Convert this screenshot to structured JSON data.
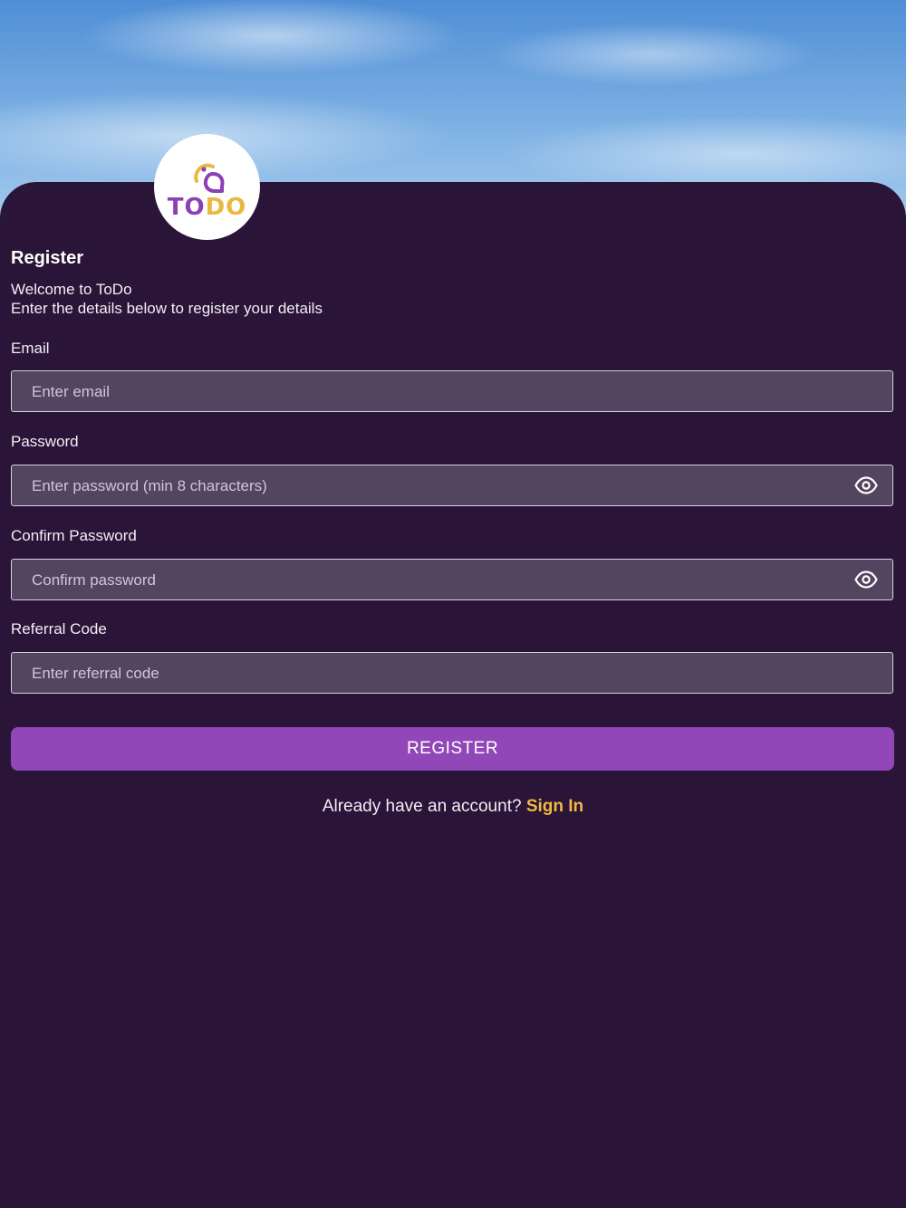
{
  "brand": {
    "logo_word_part1": "TO",
    "logo_word_part2": "DO",
    "logo_icon": "todo-location-pin-icon",
    "accent_purple": "#8d3fb5",
    "accent_gold": "#e9b93f"
  },
  "header": {
    "title": "Register",
    "welcome": "Welcome to ToDo",
    "instructions": "Enter the details below to register your details"
  },
  "form": {
    "email": {
      "label": "Email",
      "placeholder": "Enter email",
      "value": ""
    },
    "password": {
      "label": "Password",
      "placeholder": "Enter password (min 8 characters)",
      "value": "",
      "toggle_icon": "eye-icon"
    },
    "confirm_password": {
      "label": "Confirm Password",
      "placeholder": "Confirm password",
      "value": "",
      "toggle_icon": "eye-icon"
    },
    "referral": {
      "label": "Referral Code",
      "placeholder": "Enter referral code",
      "value": ""
    },
    "submit_label": "REGISTER"
  },
  "footer": {
    "prompt": "Already have an account?",
    "signin_label": "Sign In"
  },
  "colors": {
    "background": "#2a1437",
    "button": "#9147b8",
    "link": "#f1b942"
  }
}
